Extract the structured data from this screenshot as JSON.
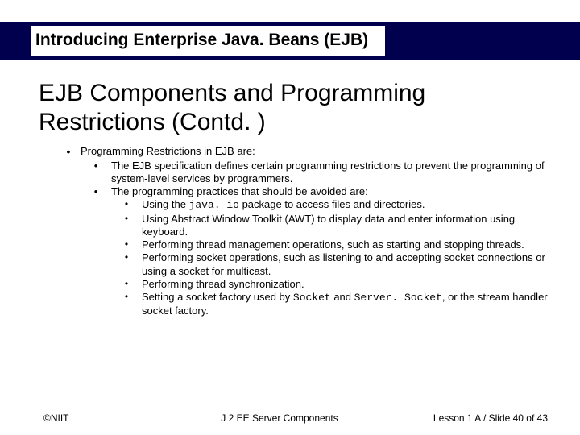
{
  "header": {
    "brand_title": "Introducing Enterprise Java. Beans (EJB)"
  },
  "title": "EJB Components and Programming Restrictions (Contd. )",
  "bullets": {
    "b1": "Programming Restrictions in EJB are:",
    "b1_1": "The EJB specification defines certain programming restrictions to prevent the programming of system-level services by programmers.",
    "b1_2": "The programming practices that should be avoided are:",
    "b1_2_1a": "Using the ",
    "b1_2_1code": "java. io",
    "b1_2_1b": " package to access files and directories.",
    "b1_2_2": "Using Abstract Window Toolkit (AWT) to display data and enter information using keyboard.",
    "b1_2_3": "Performing thread management operations, such as starting and stopping threads.",
    "b1_2_4": "Performing socket operations, such as listening to and accepting socket connections or using a socket for multicast.",
    "b1_2_5": "Performing thread synchronization.",
    "b1_2_6a": "Setting a socket factory used by ",
    "b1_2_6code1": "Socket",
    "b1_2_6b": " and ",
    "b1_2_6code2": "Server. Socket",
    "b1_2_6c": ", or the stream handler socket factory."
  },
  "footer": {
    "left": "©NIIT",
    "center": "J 2 EE Server Components",
    "right": "Lesson 1 A / Slide 40 of 43"
  }
}
